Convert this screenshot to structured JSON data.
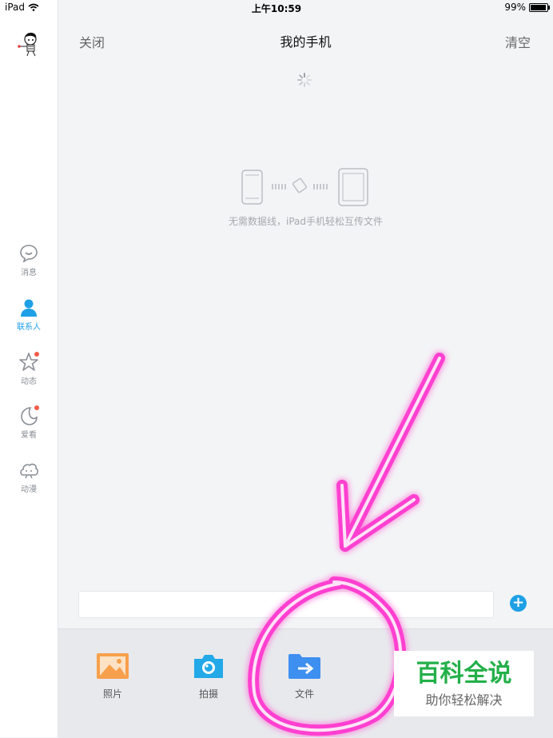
{
  "status_bar": {
    "device": "iPad",
    "time": "上午10:59",
    "battery": "99%"
  },
  "sidebar": {
    "items": [
      {
        "label": "消息",
        "icon": "chat-bubble-icon",
        "active": false,
        "badge": false
      },
      {
        "label": "联系人",
        "icon": "person-icon",
        "active": true,
        "badge": false
      },
      {
        "label": "动态",
        "icon": "star-icon",
        "active": false,
        "badge": true
      },
      {
        "label": "爱看",
        "icon": "moon-icon",
        "active": false,
        "badge": true
      },
      {
        "label": "动漫",
        "icon": "cloud-face-icon",
        "active": false,
        "badge": false
      }
    ]
  },
  "header": {
    "close": "关闭",
    "title": "我的手机",
    "clear": "清空"
  },
  "content": {
    "hint": "无需数据线，iPad手机轻松互传文件"
  },
  "input": {
    "value": "",
    "plus": "+"
  },
  "tools": [
    {
      "label": "照片",
      "icon": "photo-icon",
      "color": "#f7a04c"
    },
    {
      "label": "拍摄",
      "icon": "camera-icon",
      "color": "#23a9e8"
    },
    {
      "label": "文件",
      "icon": "folder-arrow-icon",
      "color": "#3d8ff0"
    }
  ],
  "watermark": {
    "title": "百科全说",
    "subtitle": "助你轻松解决"
  },
  "colors": {
    "accent": "#1ea0e6",
    "badge": "#f35b4a",
    "annotation": "#ff3fd0",
    "watermark_green": "#23b04a"
  }
}
